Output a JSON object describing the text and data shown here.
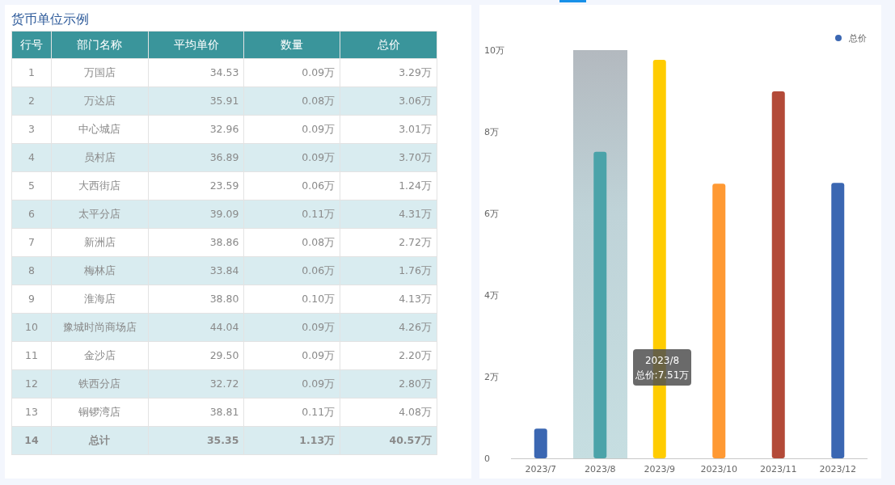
{
  "table_panel": {
    "title": "货币单位示例",
    "table": {
      "columns": [
        "行号",
        "部门名称",
        "平均单价",
        "数量",
        "总价"
      ],
      "rows": [
        [
          "1",
          "万国店",
          "34.53",
          "0.09万",
          "3.29万"
        ],
        [
          "2",
          "万达店",
          "35.91",
          "0.08万",
          "3.06万"
        ],
        [
          "3",
          "中心城店",
          "32.96",
          "0.09万",
          "3.01万"
        ],
        [
          "4",
          "员村店",
          "36.89",
          "0.09万",
          "3.70万"
        ],
        [
          "5",
          "大西街店",
          "23.59",
          "0.06万",
          "1.24万"
        ],
        [
          "6",
          "太平分店",
          "39.09",
          "0.11万",
          "4.31万"
        ],
        [
          "7",
          "新洲店",
          "38.86",
          "0.08万",
          "2.72万"
        ],
        [
          "8",
          "梅林店",
          "33.84",
          "0.06万",
          "1.76万"
        ],
        [
          "9",
          "淮海店",
          "38.80",
          "0.10万",
          "4.13万"
        ],
        [
          "10",
          "豫城时尚商场店",
          "44.04",
          "0.09万",
          "4.26万"
        ],
        [
          "11",
          "金沙店",
          "29.50",
          "0.09万",
          "2.20万"
        ],
        [
          "12",
          "铁西分店",
          "32.72",
          "0.09万",
          "2.80万"
        ],
        [
          "13",
          "铜锣湾店",
          "38.81",
          "0.11万",
          "4.08万"
        ]
      ],
      "total": [
        "14",
        "总计",
        "35.35",
        "1.13万",
        "40.57万"
      ]
    }
  },
  "chart_panel": {
    "chart_data": {
      "type": "bar",
      "categories": [
        "2023/7",
        "2023/8",
        "2023/9",
        "2023/10",
        "2023/11",
        "2023/12"
      ],
      "series": [
        {
          "name": "总价",
          "values": [
            0.73,
            7.51,
            9.76,
            6.73,
            8.99,
            6.75
          ]
        }
      ],
      "ylim": [
        0,
        10
      ],
      "yticks": [
        {
          "value": 0,
          "label": "0"
        },
        {
          "value": 2,
          "label": "2万"
        },
        {
          "value": 4,
          "label": "4万"
        },
        {
          "value": 6,
          "label": "6万"
        },
        {
          "value": 8,
          "label": "8万"
        },
        {
          "value": 10,
          "label": "10万"
        }
      ]
    },
    "legend_marker": {
      "color": "#3b67b2"
    },
    "bars": [
      {
        "color": "#3b67b2",
        "hovered": false
      },
      {
        "color": "#4ba3a9",
        "hovered": true
      },
      {
        "color": "#ffcc00",
        "hovered": false
      },
      {
        "color": "#ff9933",
        "hovered": false
      },
      {
        "color": "#b34a38",
        "hovered": false
      },
      {
        "color": "#3b67b2",
        "hovered": false
      }
    ],
    "tooltip": {
      "title": "2023/8",
      "text": "总价:7.51万"
    }
  }
}
